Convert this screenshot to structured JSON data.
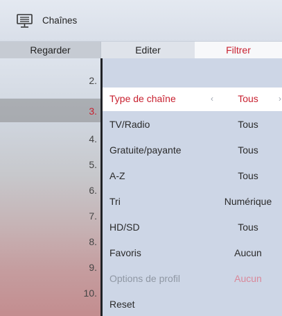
{
  "header": {
    "title": "Chaînes",
    "icon": "tv-channel-list-icon"
  },
  "tabs": [
    {
      "label": "Regarder"
    },
    {
      "label": "Editer"
    },
    {
      "label": "Filtrer"
    }
  ],
  "channel_numbers": [
    "2.",
    "3.",
    "4.",
    "5.",
    "6.",
    "7.",
    "8.",
    "9.",
    "10."
  ],
  "selected_channel_index": 1,
  "filters": [
    {
      "label": "Type de chaîne",
      "value": "Tous"
    },
    {
      "label": "TV/Radio",
      "value": "Tous"
    },
    {
      "label": "Gratuite/payante",
      "value": "Tous"
    },
    {
      "label": "A-Z",
      "value": "Tous"
    },
    {
      "label": "Tri",
      "value": "Numérique"
    },
    {
      "label": "HD/SD",
      "value": "Tous"
    },
    {
      "label": "Favoris",
      "value": "Aucun"
    },
    {
      "label": "Options de profil",
      "value": "Aucun"
    },
    {
      "label": "Reset",
      "value": ""
    }
  ],
  "arrows": {
    "left": "‹",
    "right": "›"
  },
  "colors": {
    "accent": "#c8202f",
    "panel": "#cdd6e6",
    "divider": "#202226"
  }
}
